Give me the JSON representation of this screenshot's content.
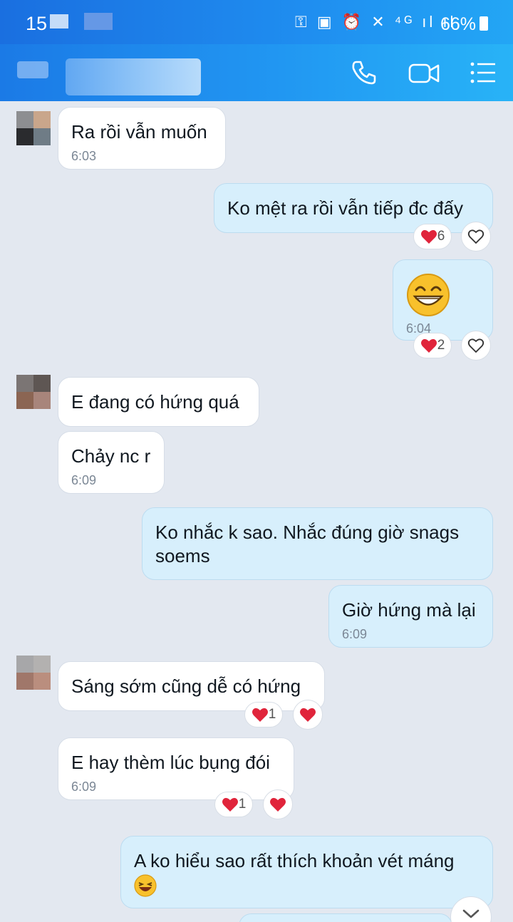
{
  "status_bar": {
    "time": "15",
    "icons": "⚿ ▣ ⏰ ✕ ⁴ᴳ ıl ıl",
    "battery": "66%"
  },
  "header": {
    "actions": [
      "phone-icon",
      "video-call-icon",
      "menu-icon"
    ]
  },
  "colors": {
    "header": "#1f8ef0",
    "incoming": "#ffffff",
    "outgoing": "#d7effc",
    "heart": "#e0243b"
  },
  "messages": [
    {
      "dir": "in",
      "text": "Ra rồi vẫn muốn",
      "time": "6:03"
    },
    {
      "dir": "out",
      "text": "Ko mệt ra rồi vẫn tiếp đc đấy",
      "reaction_count": "6"
    },
    {
      "dir": "out",
      "emoji": "grinning-face",
      "time": "6:04",
      "reaction_count": "2"
    },
    {
      "dir": "in",
      "text": "E đang có hứng quá"
    },
    {
      "dir": "in",
      "text": "Chảy nc r",
      "time": "6:09"
    },
    {
      "dir": "out",
      "text": "Ko nhắc k sao. Nhắc đúng giờ snags\nsoems"
    },
    {
      "dir": "out",
      "text": "Giờ hứng mà lại",
      "time": "6:09"
    },
    {
      "dir": "in",
      "text": "Sáng sớm cũng dễ có hứng",
      "reaction_count": "1"
    },
    {
      "dir": "in",
      "text": "E hay thèm lúc bụng đói",
      "time": "6:09",
      "reaction_count": "1"
    },
    {
      "dir": "out",
      "text": "A ko hiểu sao rất thích khoản vét máng"
    }
  ]
}
